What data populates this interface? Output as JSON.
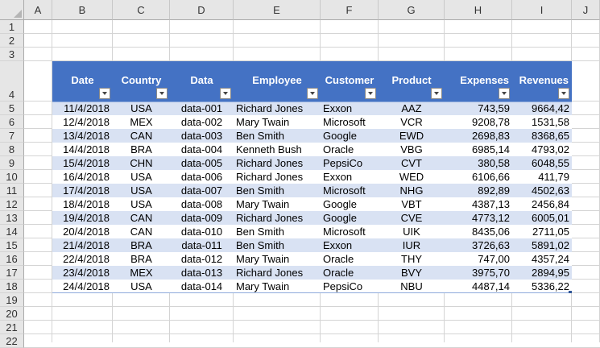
{
  "columns": [
    "A",
    "B",
    "C",
    "D",
    "E",
    "F",
    "G",
    "H",
    "I",
    "J"
  ],
  "rows": [
    "1",
    "2",
    "3",
    "4",
    "5",
    "6",
    "7",
    "8",
    "9",
    "10",
    "11",
    "12",
    "13",
    "14",
    "15",
    "16",
    "17",
    "18",
    "19",
    "20",
    "21",
    "22"
  ],
  "headers": [
    "Date",
    "Country",
    "Data",
    "Employee",
    "Customer",
    "Product",
    "Expenses",
    "Revenues"
  ],
  "table": [
    [
      "11/4/2018",
      "USA",
      "data-001",
      "Richard Jones",
      "Exxon",
      "AAZ",
      "743,59",
      "9664,42"
    ],
    [
      "12/4/2018",
      "MEX",
      "data-002",
      "Mary Twain",
      "Microsoft",
      "VCR",
      "9208,78",
      "1531,58"
    ],
    [
      "13/4/2018",
      "CAN",
      "data-003",
      "Ben Smith",
      "Google",
      "EWD",
      "2698,83",
      "8368,65"
    ],
    [
      "14/4/2018",
      "BRA",
      "data-004",
      "Kenneth Bush",
      "Oracle",
      "VBG",
      "6985,14",
      "4793,02"
    ],
    [
      "15/4/2018",
      "CHN",
      "data-005",
      "Richard Jones",
      "PepsiCo",
      "CVT",
      "380,58",
      "6048,55"
    ],
    [
      "16/4/2018",
      "USA",
      "data-006",
      "Richard Jones",
      "Exxon",
      "WED",
      "6106,66",
      "411,79"
    ],
    [
      "17/4/2018",
      "USA",
      "data-007",
      "Ben Smith",
      "Microsoft",
      "NHG",
      "892,89",
      "4502,63"
    ],
    [
      "18/4/2018",
      "USA",
      "data-008",
      "Mary Twain",
      "Google",
      "VBT",
      "4387,13",
      "2456,84"
    ],
    [
      "19/4/2018",
      "CAN",
      "data-009",
      "Richard Jones",
      "Google",
      "CVE",
      "4773,12",
      "6005,01"
    ],
    [
      "20/4/2018",
      "CAN",
      "data-010",
      "Ben Smith",
      "Microsoft",
      "UIK",
      "8435,06",
      "2711,05"
    ],
    [
      "21/4/2018",
      "BRA",
      "data-011",
      "Ben Smith",
      "Exxon",
      "IUR",
      "3726,63",
      "5891,02"
    ],
    [
      "22/4/2018",
      "BRA",
      "data-012",
      "Mary Twain",
      "Oracle",
      "THY",
      "747,00",
      "4357,24"
    ],
    [
      "23/4/2018",
      "MEX",
      "data-013",
      "Richard Jones",
      "Oracle",
      "BVY",
      "3975,70",
      "2894,95"
    ],
    [
      "24/4/2018",
      "USA",
      "data-014",
      "Mary Twain",
      "PepsiCo",
      "NBU",
      "4487,14",
      "5336,22"
    ]
  ],
  "colors": {
    "header_bg": "#4472c4",
    "band": "#d9e2f3",
    "header_text": "#ffffff"
  }
}
